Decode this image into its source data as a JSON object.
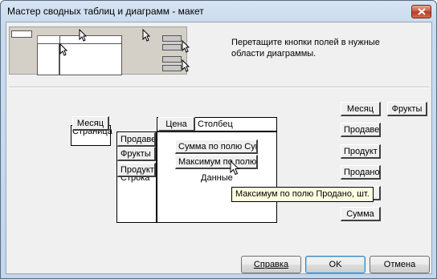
{
  "window": {
    "title": "Мастер сводных таблиц и диаграмм - макет"
  },
  "instructions": "Перетащите кнопки полей в нужные области диаграммы.",
  "areas": {
    "page": "Страница",
    "column": "Столбец",
    "row": "Строка",
    "data": "Данные"
  },
  "placed_fields": {
    "page": [
      "Месяц"
    ],
    "column": [
      "Цена"
    ],
    "row": [
      "Продавец",
      "Фрукты",
      "Продукт"
    ],
    "data": [
      "Сумма по полю Сум",
      "Максимум по полю"
    ]
  },
  "field_list": [
    "Месяц",
    "Фрукты",
    "Продавец",
    "Продукт",
    "Продано,",
    "",
    "Сумма"
  ],
  "tooltip": "Максимум по полю Продано, шт.",
  "buttons": {
    "help": "Справка",
    "ok": "OK",
    "cancel": "Отмена"
  }
}
